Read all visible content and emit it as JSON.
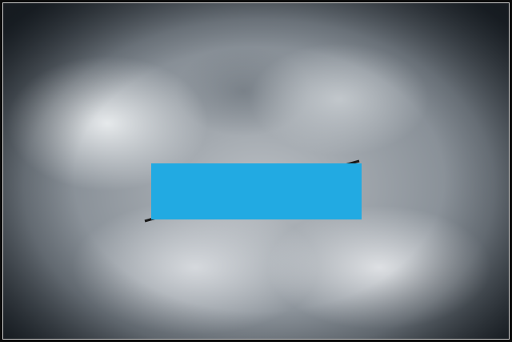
{
  "colors": {
    "cover": "#22aae2",
    "frame": "#0b0b0b"
  }
}
